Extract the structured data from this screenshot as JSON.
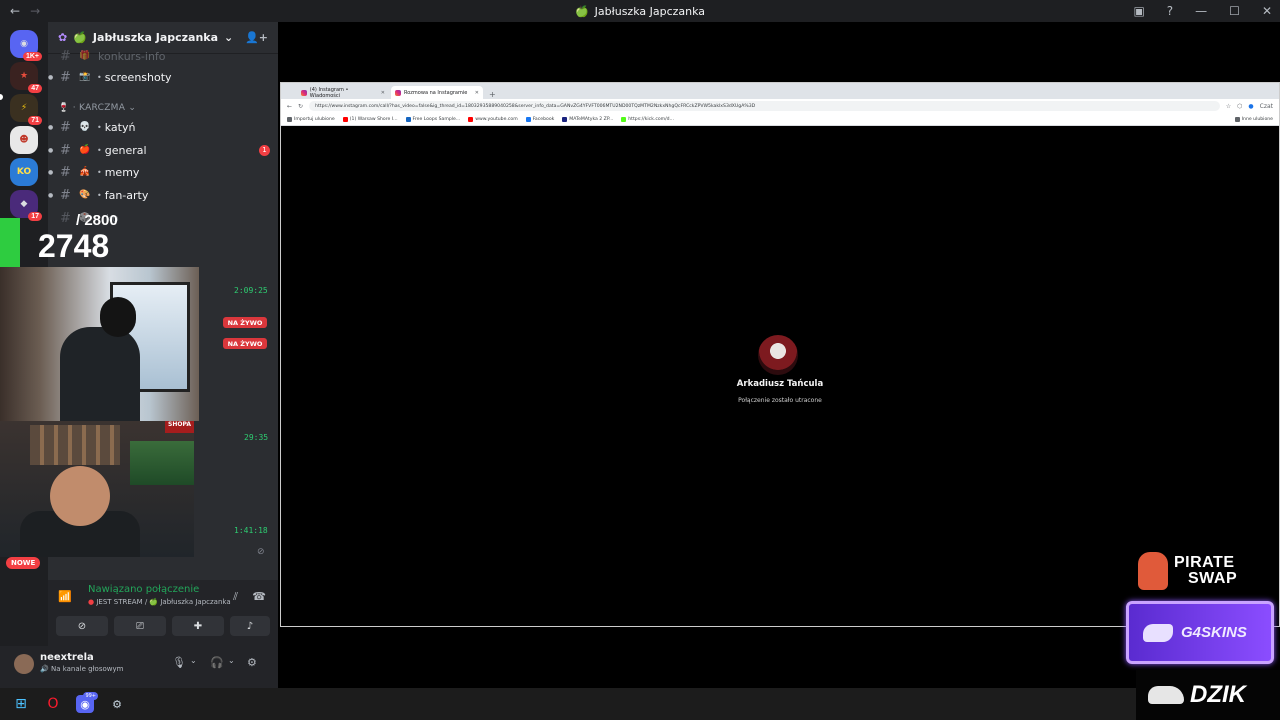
{
  "titlebar": {
    "title": "Jabłuszka Japczanka",
    "back_icon": "arrow-left-icon",
    "forward_icon": "arrow-right-icon",
    "window_controls": [
      "cast-icon",
      "help-icon",
      "minimize-icon",
      "maximize-icon",
      "close-icon"
    ]
  },
  "rail": {
    "servers": [
      {
        "badge": "1K+",
        "glyph": "◉",
        "color": "#5865f2"
      },
      {
        "badge": "47",
        "glyph": "★",
        "color": "#b03a2e"
      },
      {
        "badge": "71",
        "glyph": "⚡",
        "color": "#b07d1e"
      },
      {
        "badge": "",
        "glyph": "☻",
        "color": "#e8e8e8"
      },
      {
        "badge": "",
        "glyph": "KO",
        "color": "#2b7bd6"
      },
      {
        "badge": "17",
        "glyph": "◆",
        "color": "#4a2a7a"
      }
    ]
  },
  "sidebar": {
    "guild_name": "Jabłuszka Japczanka",
    "partial_top": "konkurs-info",
    "category": "KARCZMA",
    "channels": [
      {
        "name": "screenshoty",
        "emoji": "📸"
      },
      {
        "name": "katyń",
        "emoji": "💀"
      },
      {
        "name": "general",
        "emoji": "🍎",
        "unread": "1"
      },
      {
        "name": "memy",
        "emoji": "🎪"
      },
      {
        "name": "fan-arty",
        "emoji": "🎨"
      }
    ],
    "partial_bottom": "ko"
  },
  "overlay": {
    "total": "/ 2800",
    "count": "2748",
    "sign": "SHOPA"
  },
  "activity": {
    "time1": "2:09:25",
    "live1": "NA ŻYWO",
    "live2": "NA ŻYWO",
    "time2": "29:35",
    "time3": "1:41:18",
    "new_label": "NOWE"
  },
  "voice": {
    "status": "Nawiązano połączenie",
    "channel": "JEST STREAM / 🍏 Jabłuszka Japczanka",
    "buttons": [
      "camera-off-icon",
      "screen-share-icon",
      "activities-icon",
      "soundboard-icon"
    ]
  },
  "user": {
    "name": "neextrela",
    "status": "Na kanale głosowym"
  },
  "browser": {
    "tabs": [
      {
        "label": "(4) Instagram • Wiadomości",
        "active": false
      },
      {
        "label": "Rozmowa na Instagramie",
        "active": true
      }
    ],
    "url": "https://www.instagram.com/call/?has_video=false&ig_thread_id=18032935889040258&server_info_data=GANvZG4YFVFT006MTU2ND00TQzMTM2NzkxNhgQcFRCckZPVW5kaklxS3dXUgA%3D",
    "bookmarks": [
      {
        "label": "Importuj ulubione",
        "color": "#5f6368"
      },
      {
        "label": "(1) Warsaw Shore I...",
        "color": "#ff0000"
      },
      {
        "label": "Free Loops Sample...",
        "color": "#1565c0"
      },
      {
        "label": "www.youtube.com",
        "color": "#ff0000"
      },
      {
        "label": "Facebook",
        "color": "#1877f2"
      },
      {
        "label": "MATeMAtyka 2 ZP...",
        "color": "#1a237e"
      },
      {
        "label": "https://kick.com/d...",
        "color": "#53fc18"
      }
    ],
    "other_bookmarks": "Inne ulubione",
    "profile_label": "Czat"
  },
  "call": {
    "name": "Arkadiusz Tańcula",
    "status": "Połączenie zostało utracone"
  },
  "sponsors": {
    "pirate1": "PIRATE",
    "pirate2": "SWAP",
    "g4": "G4SKINS",
    "dzik": "DZIK"
  },
  "taskbar": {
    "items": [
      "windows-start-icon",
      "opera-icon",
      "discord-icon",
      "steam-icon"
    ],
    "discord_badge": "99+"
  }
}
